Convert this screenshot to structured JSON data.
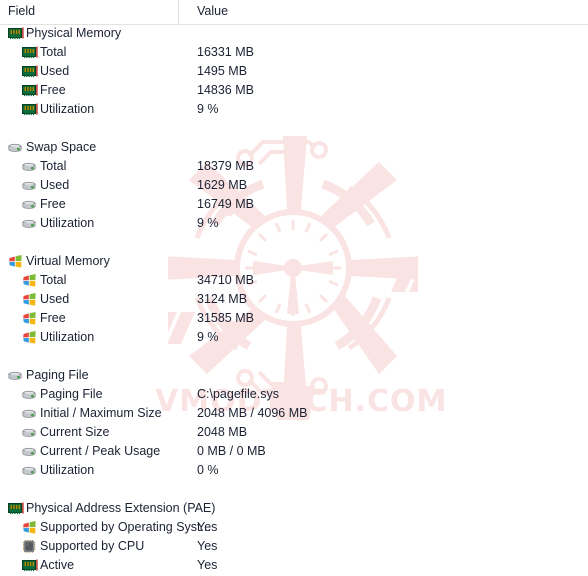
{
  "header": {
    "field_label": "Field",
    "value_label": "Value"
  },
  "watermark": {
    "text": "VMODTECH.COM",
    "color": "#fae3e3",
    "logo_icon": "radial-burst-logo"
  },
  "colors": {
    "text": "#1b2233",
    "header_rule": "#e2e2e2",
    "background": "#ffffff",
    "ram_icon_body": "#0a6d3d",
    "ram_icon_chip": "#e8b500",
    "drive_icon_body": "#b9bcc0",
    "drive_icon_led": "#4fb84f",
    "cpu_icon_body": "#6b6e73"
  },
  "rows": [
    {
      "level": 0,
      "icon": "memory-module-icon",
      "label": "Physical Memory",
      "value": ""
    },
    {
      "level": 1,
      "icon": "memory-module-icon",
      "label": "Total",
      "value": "16331 MB"
    },
    {
      "level": 1,
      "icon": "memory-module-icon",
      "label": "Used",
      "value": "1495 MB"
    },
    {
      "level": 1,
      "icon": "memory-module-icon",
      "label": "Free",
      "value": "14836 MB"
    },
    {
      "level": 1,
      "icon": "memory-module-icon",
      "label": "Utilization",
      "value": "9 %"
    },
    {
      "level": -1,
      "icon": "",
      "label": "",
      "value": ""
    },
    {
      "level": 0,
      "icon": "hard-drive-icon",
      "label": "Swap Space",
      "value": ""
    },
    {
      "level": 1,
      "icon": "hard-drive-icon",
      "label": "Total",
      "value": "18379 MB"
    },
    {
      "level": 1,
      "icon": "hard-drive-icon",
      "label": "Used",
      "value": "1629 MB"
    },
    {
      "level": 1,
      "icon": "hard-drive-icon",
      "label": "Free",
      "value": "16749 MB"
    },
    {
      "level": 1,
      "icon": "hard-drive-icon",
      "label": "Utilization",
      "value": "9 %"
    },
    {
      "level": -1,
      "icon": "",
      "label": "",
      "value": ""
    },
    {
      "level": 0,
      "icon": "windows-flag-icon",
      "label": "Virtual Memory",
      "value": ""
    },
    {
      "level": 1,
      "icon": "windows-flag-icon",
      "label": "Total",
      "value": "34710 MB"
    },
    {
      "level": 1,
      "icon": "windows-flag-icon",
      "label": "Used",
      "value": "3124 MB"
    },
    {
      "level": 1,
      "icon": "windows-flag-icon",
      "label": "Free",
      "value": "31585 MB"
    },
    {
      "level": 1,
      "icon": "windows-flag-icon",
      "label": "Utilization",
      "value": "9 %"
    },
    {
      "level": -1,
      "icon": "",
      "label": "",
      "value": ""
    },
    {
      "level": 0,
      "icon": "hard-drive-icon",
      "label": "Paging File",
      "value": ""
    },
    {
      "level": 1,
      "icon": "hard-drive-icon",
      "label": "Paging File",
      "value": "C:\\pagefile.sys"
    },
    {
      "level": 1,
      "icon": "hard-drive-icon",
      "label": "Initial / Maximum Size",
      "value": "2048 MB / 4096 MB"
    },
    {
      "level": 1,
      "icon": "hard-drive-icon",
      "label": "Current Size",
      "value": "2048 MB"
    },
    {
      "level": 1,
      "icon": "hard-drive-icon",
      "label": "Current / Peak Usage",
      "value": "0 MB / 0 MB"
    },
    {
      "level": 1,
      "icon": "hard-drive-icon",
      "label": "Utilization",
      "value": "0 %"
    },
    {
      "level": -1,
      "icon": "",
      "label": "",
      "value": ""
    },
    {
      "level": 0,
      "icon": "memory-module-icon",
      "label": "Physical Address Extension (PAE)",
      "value": ""
    },
    {
      "level": 1,
      "icon": "windows-flag-icon",
      "label": "Supported by Operating Syst...",
      "value": "Yes"
    },
    {
      "level": 1,
      "icon": "cpu-chip-icon",
      "label": "Supported by CPU",
      "value": "Yes"
    },
    {
      "level": 1,
      "icon": "memory-module-icon",
      "label": "Active",
      "value": "Yes"
    }
  ]
}
